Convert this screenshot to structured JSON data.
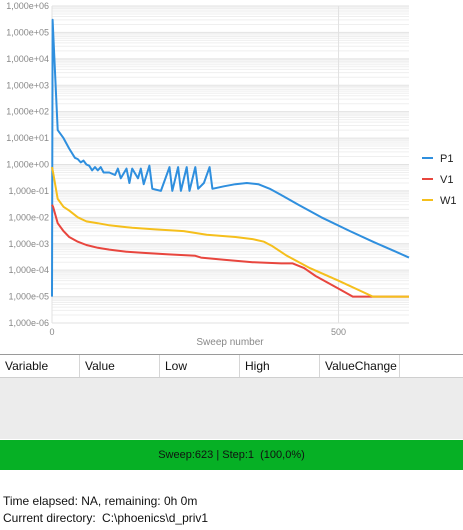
{
  "chart_data": {
    "type": "line",
    "xlabel": "Sweep number",
    "ylabel": "",
    "x_scale": "linear",
    "y_scale": "log",
    "xlim": [
      0,
      623
    ],
    "ylim": [
      1e-06,
      1000000.0
    ],
    "x_ticks": [
      {
        "value": 0,
        "label": "0"
      },
      {
        "value": 500,
        "label": "500"
      }
    ],
    "y_ticks": [
      {
        "value": 1000000.0,
        "label": "1,000e+06"
      },
      {
        "value": 100000.0,
        "label": "1,000e+05"
      },
      {
        "value": 10000.0,
        "label": "1,000e+04"
      },
      {
        "value": 1000.0,
        "label": "1,000e+03"
      },
      {
        "value": 100.0,
        "label": "1,000e+02"
      },
      {
        "value": 10.0,
        "label": "1,000e+01"
      },
      {
        "value": 1,
        "label": "1,000e+00"
      },
      {
        "value": 0.1,
        "label": "1,000e-01"
      },
      {
        "value": 0.01,
        "label": "1,000e-02"
      },
      {
        "value": 0.001,
        "label": "1,000e-03"
      },
      {
        "value": 0.0001,
        "label": "1,000e-04"
      },
      {
        "value": 1e-05,
        "label": "1,000e-05"
      },
      {
        "value": 1e-06,
        "label": "1,000e-06"
      }
    ],
    "grid": true,
    "legend_position": "right",
    "series": [
      {
        "name": "P1",
        "color": "#2f8fde",
        "points": [
          [
            0,
            1e-05
          ],
          [
            1,
            300000.0
          ],
          [
            10,
            20.0
          ],
          [
            20,
            10.0
          ],
          [
            30,
            4
          ],
          [
            40,
            1.8
          ],
          [
            45,
            1.6
          ],
          [
            50,
            1.2
          ],
          [
            55,
            1.4
          ],
          [
            60,
            1.0
          ],
          [
            65,
            0.9
          ],
          [
            70,
            0.6
          ],
          [
            75,
            0.8
          ],
          [
            80,
            0.6
          ],
          [
            85,
            0.8
          ],
          [
            90,
            0.5
          ],
          [
            100,
            0.5
          ],
          [
            110,
            0.4
          ],
          [
            115,
            0.7
          ],
          [
            120,
            0.3
          ],
          [
            130,
            0.7
          ],
          [
            135,
            0.2
          ],
          [
            140,
            0.7
          ],
          [
            150,
            0.3
          ],
          [
            155,
            0.7
          ],
          [
            160,
            0.18
          ],
          [
            170,
            0.9
          ],
          [
            175,
            0.12
          ],
          [
            190,
            0.1
          ],
          [
            205,
            0.8
          ],
          [
            210,
            0.1
          ],
          [
            220,
            0.8
          ],
          [
            225,
            0.1
          ],
          [
            235,
            0.8
          ],
          [
            240,
            0.1
          ],
          [
            250,
            0.8
          ],
          [
            255,
            0.12
          ],
          [
            265,
            0.2
          ],
          [
            275,
            0.8
          ],
          [
            280,
            0.12
          ],
          [
            300,
            0.15
          ],
          [
            320,
            0.18
          ],
          [
            340,
            0.2
          ],
          [
            360,
            0.18
          ],
          [
            380,
            0.12
          ],
          [
            400,
            0.07
          ],
          [
            430,
            0.03
          ],
          [
            470,
            0.01
          ],
          [
            520,
            0.003
          ],
          [
            560,
            0.0012
          ],
          [
            600,
            0.0005
          ],
          [
            623,
            0.0003
          ]
        ]
      },
      {
        "name": "V1",
        "color": "#e8463e",
        "points": [
          [
            0,
            0.03
          ],
          [
            2,
            0.025
          ],
          [
            10,
            0.006
          ],
          [
            20,
            0.003
          ],
          [
            30,
            0.0018
          ],
          [
            45,
            0.0012
          ],
          [
            60,
            0.0009
          ],
          [
            80,
            0.0007
          ],
          [
            100,
            0.0006
          ],
          [
            130,
            0.0005
          ],
          [
            160,
            0.00045
          ],
          [
            200,
            0.0004
          ],
          [
            250,
            0.00035
          ],
          [
            260,
            0.0003
          ],
          [
            300,
            0.00025
          ],
          [
            350,
            0.0002
          ],
          [
            400,
            0.00018
          ],
          [
            420,
            0.00018
          ],
          [
            440,
            0.00012
          ],
          [
            460,
            6e-05
          ],
          [
            500,
            2e-05
          ],
          [
            525,
            1e-05
          ],
          [
            623,
            1e-05
          ]
        ]
      },
      {
        "name": "W1",
        "color": "#f5bf1c",
        "points": [
          [
            0,
            0.8
          ],
          [
            2,
            0.5
          ],
          [
            10,
            0.05
          ],
          [
            20,
            0.025
          ],
          [
            30,
            0.018
          ],
          [
            45,
            0.01
          ],
          [
            60,
            0.007
          ],
          [
            80,
            0.006
          ],
          [
            100,
            0.005
          ],
          [
            140,
            0.004
          ],
          [
            180,
            0.0035
          ],
          [
            230,
            0.003
          ],
          [
            270,
            0.0022
          ],
          [
            320,
            0.0018
          ],
          [
            350,
            0.0015
          ],
          [
            370,
            0.0012
          ],
          [
            385,
            0.0008
          ],
          [
            410,
            0.00035
          ],
          [
            450,
            0.00012
          ],
          [
            500,
            4e-05
          ],
          [
            560,
            1e-05
          ],
          [
            600,
            1e-05
          ],
          [
            623,
            1e-05
          ]
        ]
      }
    ]
  },
  "table": {
    "columns": [
      "Variable",
      "Value",
      "Low",
      "High",
      "ValueChange"
    ]
  },
  "status": {
    "text": "Sweep:623 | Step:1  (100,0%)",
    "color": "#06b025"
  },
  "info": {
    "time_text": "Time elapsed: NA, remaining: 0h 0m",
    "dir_label": "Current directory:",
    "dir_value": "C:\\phoenics\\d_priv1"
  }
}
